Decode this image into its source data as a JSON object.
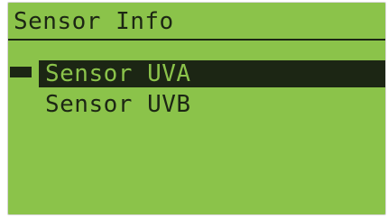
{
  "screen": {
    "title": "Sensor Info",
    "menu": {
      "items": [
        {
          "label": "Sensor UVA",
          "selected": true
        },
        {
          "label": "Sensor UVB",
          "selected": false
        }
      ]
    },
    "colors": {
      "background": "#8bc34a",
      "foreground": "#1c2614"
    }
  }
}
